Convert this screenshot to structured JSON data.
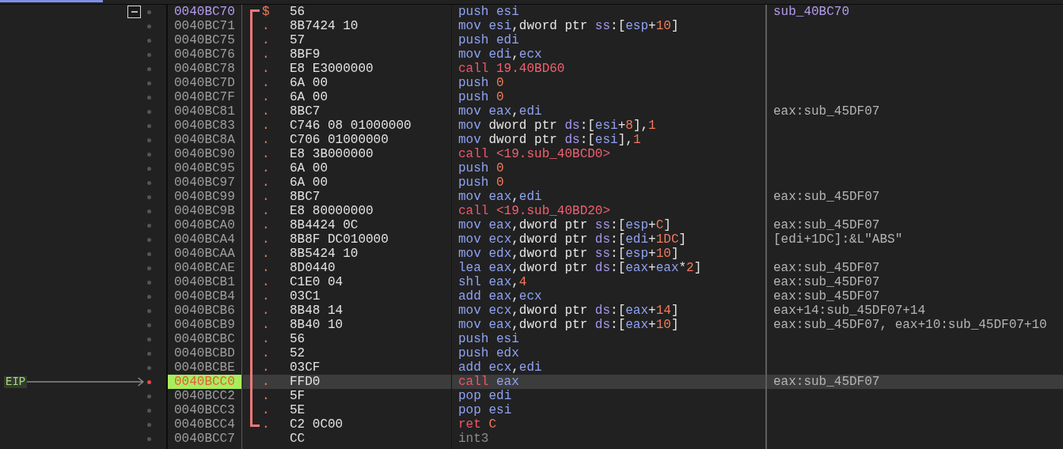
{
  "rows": [
    {
      "address": "0040BC70",
      "kind": "function_start",
      "fold": {
        "expanded": true
      },
      "marker": "$",
      "in_function": true,
      "bytes": "56",
      "instruction": [
        {
          "kind": "mnemonic",
          "text": "push"
        },
        {
          "kind": "register",
          "text": "esi"
        }
      ],
      "comment": {
        "text": "sub_40BC70",
        "kind": "label"
      },
      "selected": false
    },
    {
      "address": "0040BC71",
      "kind": "code",
      "marker": ".",
      "in_function": true,
      "bytes": "8B7424 10",
      "instruction": [
        {
          "kind": "mnemonic",
          "text": "mov"
        },
        {
          "kind": "register",
          "text": "esi"
        },
        {
          "kind": "keyword",
          "text": ",dword ptr"
        },
        {
          "kind": "segment",
          "text": "ss"
        },
        {
          "kind": "plain",
          "text": ":["
        },
        {
          "kind": "register",
          "text": "esp"
        },
        {
          "kind": "plain",
          "text": "+"
        },
        {
          "kind": "number",
          "text": "10"
        },
        {
          "kind": "plain",
          "text": "]"
        }
      ],
      "selected": false
    },
    {
      "address": "0040BC75",
      "kind": "code",
      "marker": ".",
      "in_function": true,
      "bytes": "57",
      "instruction": [
        {
          "kind": "mnemonic",
          "text": "push"
        },
        {
          "kind": "register",
          "text": "edi"
        }
      ],
      "selected": false
    },
    {
      "address": "0040BC76",
      "kind": "code",
      "marker": ".",
      "in_function": true,
      "bytes": "8BF9",
      "instruction": [
        {
          "kind": "mnemonic",
          "text": "mov"
        },
        {
          "kind": "register",
          "text": "edi"
        },
        {
          "kind": "plain",
          "text": ","
        },
        {
          "kind": "register",
          "text": "ecx"
        }
      ],
      "selected": false
    },
    {
      "address": "0040BC78",
      "kind": "code",
      "marker": ".",
      "in_function": true,
      "bytes": "E8 E3000000",
      "instruction": [
        {
          "kind": "call",
          "text": "call"
        },
        {
          "kind": "symbol",
          "text": "19.40BD60"
        }
      ],
      "selected": false
    },
    {
      "address": "0040BC7D",
      "kind": "code",
      "marker": ".",
      "in_function": true,
      "bytes": "6A 00",
      "instruction": [
        {
          "kind": "mnemonic",
          "text": "push"
        },
        {
          "kind": "number",
          "text": "0"
        }
      ],
      "selected": false
    },
    {
      "address": "0040BC7F",
      "kind": "code",
      "marker": ".",
      "in_function": true,
      "bytes": "6A 00",
      "instruction": [
        {
          "kind": "mnemonic",
          "text": "push"
        },
        {
          "kind": "number",
          "text": "0"
        }
      ],
      "selected": false
    },
    {
      "address": "0040BC81",
      "kind": "code",
      "marker": ".",
      "in_function": true,
      "bytes": "8BC7",
      "instruction": [
        {
          "kind": "mnemonic",
          "text": "mov"
        },
        {
          "kind": "register",
          "text": "eax"
        },
        {
          "kind": "plain",
          "text": ","
        },
        {
          "kind": "register",
          "text": "edi"
        }
      ],
      "comment": {
        "text": "eax:sub_45DF07",
        "kind": "auto"
      },
      "selected": false
    },
    {
      "address": "0040BC83",
      "kind": "code",
      "marker": ".",
      "in_function": true,
      "bytes": "C746 08 01000000",
      "instruction": [
        {
          "kind": "mnemonic",
          "text": "mov"
        },
        {
          "kind": "keyword",
          "text": "dword ptr"
        },
        {
          "kind": "segment",
          "text": "ds"
        },
        {
          "kind": "plain",
          "text": ":["
        },
        {
          "kind": "register",
          "text": "esi"
        },
        {
          "kind": "plain",
          "text": "+"
        },
        {
          "kind": "number",
          "text": "8"
        },
        {
          "kind": "plain",
          "text": "],"
        },
        {
          "kind": "number",
          "text": "1"
        }
      ],
      "selected": false
    },
    {
      "address": "0040BC8A",
      "kind": "code",
      "marker": ".",
      "in_function": true,
      "bytes": "C706 01000000",
      "instruction": [
        {
          "kind": "mnemonic",
          "text": "mov"
        },
        {
          "kind": "keyword",
          "text": "dword ptr"
        },
        {
          "kind": "segment",
          "text": "ds"
        },
        {
          "kind": "plain",
          "text": ":["
        },
        {
          "kind": "register",
          "text": "esi"
        },
        {
          "kind": "plain",
          "text": "],"
        },
        {
          "kind": "number",
          "text": "1"
        }
      ],
      "selected": false
    },
    {
      "address": "0040BC90",
      "kind": "code",
      "marker": ".",
      "in_function": true,
      "bytes": "E8 3B000000",
      "instruction": [
        {
          "kind": "call",
          "text": "call"
        },
        {
          "kind": "symbol",
          "text": "<19.sub_40BCD0>"
        }
      ],
      "selected": false
    },
    {
      "address": "0040BC95",
      "kind": "code",
      "marker": ".",
      "in_function": true,
      "bytes": "6A 00",
      "instruction": [
        {
          "kind": "mnemonic",
          "text": "push"
        },
        {
          "kind": "number",
          "text": "0"
        }
      ],
      "selected": false
    },
    {
      "address": "0040BC97",
      "kind": "code",
      "marker": ".",
      "in_function": true,
      "bytes": "6A 00",
      "instruction": [
        {
          "kind": "mnemonic",
          "text": "push"
        },
        {
          "kind": "number",
          "text": "0"
        }
      ],
      "selected": false
    },
    {
      "address": "0040BC99",
      "kind": "code",
      "marker": ".",
      "in_function": true,
      "bytes": "8BC7",
      "instruction": [
        {
          "kind": "mnemonic",
          "text": "mov"
        },
        {
          "kind": "register",
          "text": "eax"
        },
        {
          "kind": "plain",
          "text": ","
        },
        {
          "kind": "register",
          "text": "edi"
        }
      ],
      "comment": {
        "text": "eax:sub_45DF07",
        "kind": "auto"
      },
      "selected": false
    },
    {
      "address": "0040BC9B",
      "kind": "code",
      "marker": ".",
      "in_function": true,
      "bytes": "E8 80000000",
      "instruction": [
        {
          "kind": "call",
          "text": "call"
        },
        {
          "kind": "symbol",
          "text": "<19.sub_40BD20>"
        }
      ],
      "selected": false
    },
    {
      "address": "0040BCA0",
      "kind": "code",
      "marker": ".",
      "in_function": true,
      "bytes": "8B4424 0C",
      "instruction": [
        {
          "kind": "mnemonic",
          "text": "mov"
        },
        {
          "kind": "register",
          "text": "eax"
        },
        {
          "kind": "keyword",
          "text": ",dword ptr"
        },
        {
          "kind": "segment",
          "text": "ss"
        },
        {
          "kind": "plain",
          "text": ":["
        },
        {
          "kind": "register",
          "text": "esp"
        },
        {
          "kind": "plain",
          "text": "+"
        },
        {
          "kind": "number",
          "text": "C"
        },
        {
          "kind": "plain",
          "text": "]"
        }
      ],
      "comment": {
        "text": "eax:sub_45DF07",
        "kind": "auto"
      },
      "selected": false
    },
    {
      "address": "0040BCA4",
      "kind": "code",
      "marker": ".",
      "in_function": true,
      "bytes": "8B8F DC010000",
      "instruction": [
        {
          "kind": "mnemonic",
          "text": "mov"
        },
        {
          "kind": "register",
          "text": "ecx"
        },
        {
          "kind": "keyword",
          "text": ",dword ptr"
        },
        {
          "kind": "segment",
          "text": "ds"
        },
        {
          "kind": "plain",
          "text": ":["
        },
        {
          "kind": "register",
          "text": "edi"
        },
        {
          "kind": "plain",
          "text": "+"
        },
        {
          "kind": "number",
          "text": "1DC"
        },
        {
          "kind": "plain",
          "text": "]"
        }
      ],
      "comment": {
        "text": "[edi+1DC]:&L\"ABS\"",
        "kind": "auto"
      },
      "selected": false
    },
    {
      "address": "0040BCAA",
      "kind": "code",
      "marker": ".",
      "in_function": true,
      "bytes": "8B5424 10",
      "instruction": [
        {
          "kind": "mnemonic",
          "text": "mov"
        },
        {
          "kind": "register",
          "text": "edx"
        },
        {
          "kind": "keyword",
          "text": ",dword ptr"
        },
        {
          "kind": "segment",
          "text": "ss"
        },
        {
          "kind": "plain",
          "text": ":["
        },
        {
          "kind": "register",
          "text": "esp"
        },
        {
          "kind": "plain",
          "text": "+"
        },
        {
          "kind": "number",
          "text": "10"
        },
        {
          "kind": "plain",
          "text": "]"
        }
      ],
      "selected": false
    },
    {
      "address": "0040BCAE",
      "kind": "code",
      "marker": ".",
      "in_function": true,
      "bytes": "8D0440",
      "instruction": [
        {
          "kind": "mnemonic",
          "text": "lea"
        },
        {
          "kind": "register",
          "text": "eax"
        },
        {
          "kind": "keyword",
          "text": ",dword ptr"
        },
        {
          "kind": "segment",
          "text": "ds"
        },
        {
          "kind": "plain",
          "text": ":["
        },
        {
          "kind": "register",
          "text": "eax"
        },
        {
          "kind": "plain",
          "text": "+"
        },
        {
          "kind": "register",
          "text": "eax"
        },
        {
          "kind": "plain",
          "text": "*"
        },
        {
          "kind": "number",
          "text": "2"
        },
        {
          "kind": "plain",
          "text": "]"
        }
      ],
      "comment": {
        "text": "eax:sub_45DF07",
        "kind": "auto"
      },
      "selected": false
    },
    {
      "address": "0040BCB1",
      "kind": "code",
      "marker": ".",
      "in_function": true,
      "bytes": "C1E0 04",
      "instruction": [
        {
          "kind": "mnemonic",
          "text": "shl"
        },
        {
          "kind": "register",
          "text": "eax"
        },
        {
          "kind": "plain",
          "text": ","
        },
        {
          "kind": "number",
          "text": "4"
        }
      ],
      "comment": {
        "text": "eax:sub_45DF07",
        "kind": "auto"
      },
      "selected": false
    },
    {
      "address": "0040BCB4",
      "kind": "code",
      "marker": ".",
      "in_function": true,
      "bytes": "03C1",
      "instruction": [
        {
          "kind": "mnemonic",
          "text": "add"
        },
        {
          "kind": "register",
          "text": "eax"
        },
        {
          "kind": "plain",
          "text": ","
        },
        {
          "kind": "register",
          "text": "ecx"
        }
      ],
      "comment": {
        "text": "eax:sub_45DF07",
        "kind": "auto"
      },
      "selected": false
    },
    {
      "address": "0040BCB6",
      "kind": "code",
      "marker": ".",
      "in_function": true,
      "bytes": "8B48 14",
      "instruction": [
        {
          "kind": "mnemonic",
          "text": "mov"
        },
        {
          "kind": "register",
          "text": "ecx"
        },
        {
          "kind": "keyword",
          "text": ",dword ptr"
        },
        {
          "kind": "segment",
          "text": "ds"
        },
        {
          "kind": "plain",
          "text": ":["
        },
        {
          "kind": "register",
          "text": "eax"
        },
        {
          "kind": "plain",
          "text": "+"
        },
        {
          "kind": "number",
          "text": "14"
        },
        {
          "kind": "plain",
          "text": "]"
        }
      ],
      "comment": {
        "text": "eax+14:sub_45DF07+14",
        "kind": "auto"
      },
      "selected": false
    },
    {
      "address": "0040BCB9",
      "kind": "code",
      "marker": ".",
      "in_function": true,
      "bytes": "8B40 10",
      "instruction": [
        {
          "kind": "mnemonic",
          "text": "mov"
        },
        {
          "kind": "register",
          "text": "eax"
        },
        {
          "kind": "keyword",
          "text": ",dword ptr"
        },
        {
          "kind": "segment",
          "text": "ds"
        },
        {
          "kind": "plain",
          "text": ":["
        },
        {
          "kind": "register",
          "text": "eax"
        },
        {
          "kind": "plain",
          "text": "+"
        },
        {
          "kind": "number",
          "text": "10"
        },
        {
          "kind": "plain",
          "text": "]"
        }
      ],
      "comment": {
        "text": "eax:sub_45DF07, eax+10:sub_45DF07+10",
        "kind": "auto"
      },
      "selected": false
    },
    {
      "address": "0040BCBC",
      "kind": "code",
      "marker": ".",
      "in_function": true,
      "bytes": "56",
      "instruction": [
        {
          "kind": "mnemonic",
          "text": "push"
        },
        {
          "kind": "register",
          "text": "esi"
        }
      ],
      "selected": false
    },
    {
      "address": "0040BCBD",
      "kind": "code",
      "marker": ".",
      "in_function": true,
      "bytes": "52",
      "instruction": [
        {
          "kind": "mnemonic",
          "text": "push"
        },
        {
          "kind": "register",
          "text": "edx"
        }
      ],
      "selected": false
    },
    {
      "address": "0040BCBE",
      "kind": "code",
      "marker": ".",
      "in_function": true,
      "bytes": "03CF",
      "instruction": [
        {
          "kind": "mnemonic",
          "text": "add"
        },
        {
          "kind": "register",
          "text": "ecx"
        },
        {
          "kind": "plain",
          "text": ","
        },
        {
          "kind": "register",
          "text": "edi"
        }
      ],
      "selected": false
    },
    {
      "address": "0040BCC0",
      "kind": "code",
      "label": "EIP",
      "marker": ".",
      "in_function": true,
      "bytes": "FFD0",
      "instruction": [
        {
          "kind": "call",
          "text": "call"
        },
        {
          "kind": "register",
          "text": "eax"
        }
      ],
      "comment": {
        "text": "eax:sub_45DF07",
        "kind": "auto"
      },
      "selected": true
    },
    {
      "address": "0040BCC2",
      "kind": "code",
      "marker": ".",
      "in_function": true,
      "bytes": "5F",
      "instruction": [
        {
          "kind": "mnemonic",
          "text": "pop"
        },
        {
          "kind": "register",
          "text": "edi"
        }
      ],
      "selected": false
    },
    {
      "address": "0040BCC3",
      "kind": "code",
      "marker": ".",
      "in_function": true,
      "bytes": "5E",
      "instruction": [
        {
          "kind": "mnemonic",
          "text": "pop"
        },
        {
          "kind": "register",
          "text": "esi"
        }
      ],
      "selected": false
    },
    {
      "address": "0040BCC4",
      "kind": "code",
      "marker": ".",
      "in_function": true,
      "bytes": "C2 0C00",
      "instruction": [
        {
          "kind": "call",
          "text": "ret"
        },
        {
          "kind": "number",
          "text": "C"
        }
      ],
      "selected": false
    },
    {
      "address": "0040BCC7",
      "kind": "padding",
      "in_function": false,
      "bytes": "CC",
      "instruction": [
        {
          "kind": "padding",
          "text": "int3"
        }
      ],
      "selected": false
    }
  ]
}
